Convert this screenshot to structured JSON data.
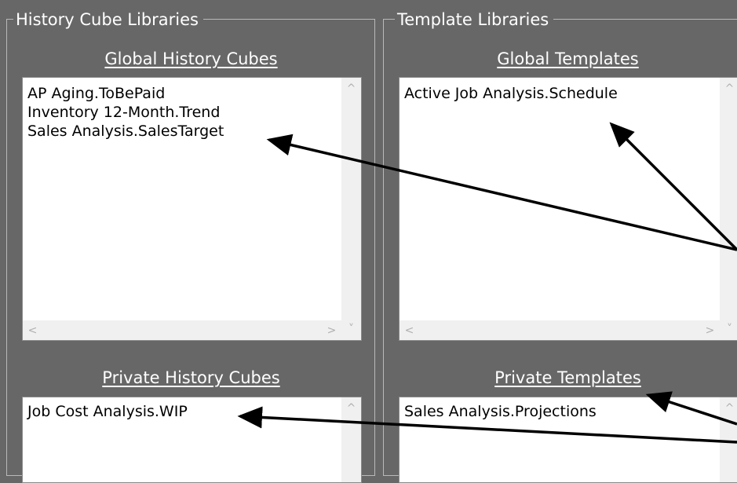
{
  "history_libraries": {
    "title": "History Cube Libraries",
    "global": {
      "label": "Global History Cubes",
      "items": [
        "AP Aging.ToBePaid",
        "Inventory 12-Month.Trend",
        "Sales Analysis.SalesTarget"
      ]
    },
    "private": {
      "label": "Private History Cubes",
      "items": [
        "Job Cost Analysis.WIP"
      ]
    }
  },
  "template_libraries": {
    "title": "Template Libraries",
    "global": {
      "label": "Global Templates",
      "items": [
        "Active Job Analysis.Schedule"
      ]
    },
    "private": {
      "label": "Private Templates",
      "items": [
        "Sales Analysis.Projections"
      ]
    }
  },
  "scroll_glyphs": {
    "up": "^",
    "down": "˅",
    "left": "<",
    "right": ">"
  },
  "colors": {
    "panel_bg": "#676767",
    "list_bg": "#ffffff",
    "arrow": "#000000"
  }
}
